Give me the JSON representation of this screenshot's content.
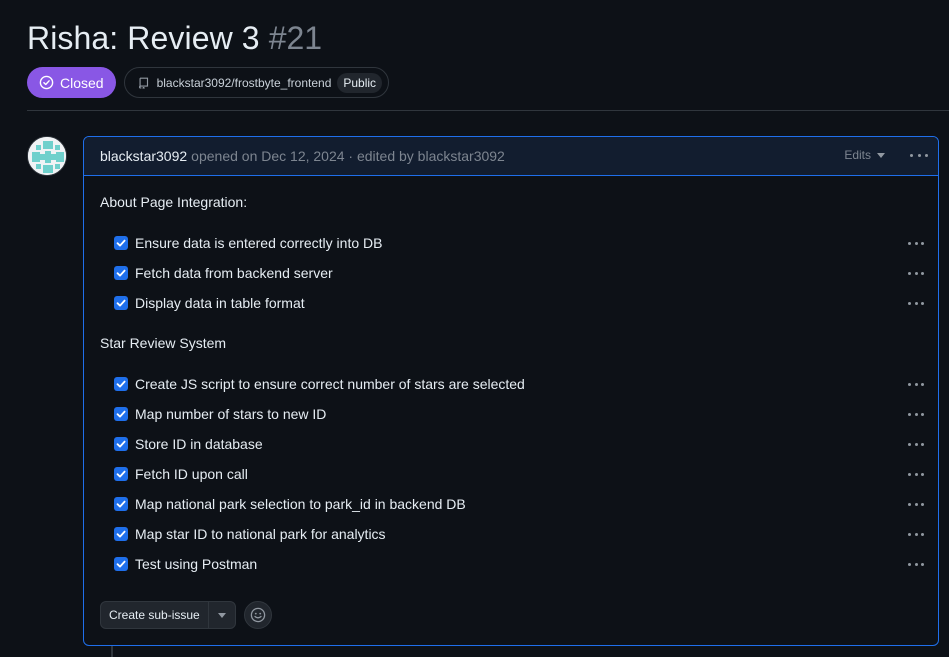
{
  "issue": {
    "title": "Risha: Review 3",
    "number": "#21",
    "state": "Closed",
    "repo": "blackstar3092/frostbyte_frontend",
    "visibility": "Public"
  },
  "comment": {
    "author": "blackstar3092",
    "meta": "opened on Dec 12, 2024 · edited by blackstar3092",
    "edits_label": "Edits",
    "sections": [
      {
        "title": "About Page Integration:",
        "tasks": [
          "Ensure data is entered correctly into DB",
          "Fetch data from backend server",
          "Display data in table format"
        ]
      },
      {
        "title": "Star Review System",
        "tasks": [
          "Create JS script to ensure correct number of stars are selected",
          "Map number of stars to new ID",
          "Store ID in database",
          "Fetch ID upon call",
          "Map national park selection to park_id in backend DB",
          "Map star ID to national park for analytics",
          "Test using Postman"
        ]
      }
    ],
    "create_sub_issue_label": "Create sub-issue"
  },
  "colors": {
    "closed_badge": "#8957e5",
    "accent_border": "#1f6feb",
    "checkbox": "#1f6feb"
  },
  "icons": [
    "issue-closed-icon",
    "repo-icon",
    "chevron-down-icon",
    "kebab-horizontal-icon",
    "check-icon",
    "smiley-icon"
  ]
}
